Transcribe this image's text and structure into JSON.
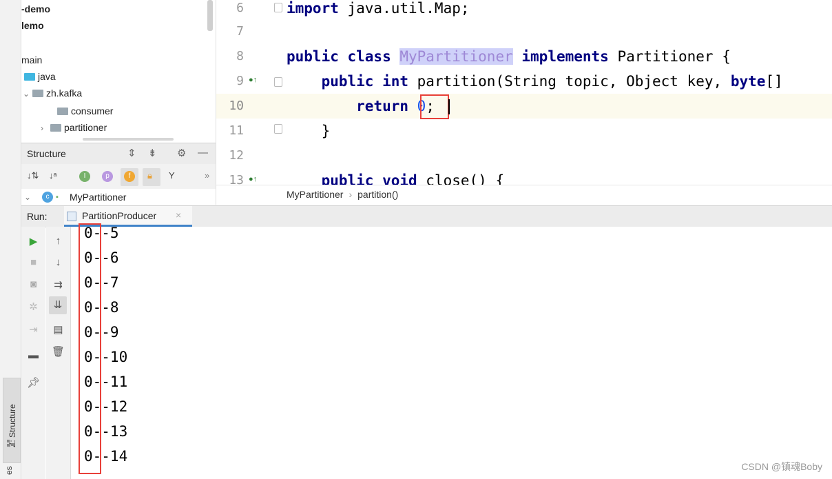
{
  "project_tree": {
    "items": [
      {
        "label": "-demo",
        "bold": true
      },
      {
        "label": "lemo",
        "bold": true
      },
      {
        "label": "main"
      },
      {
        "label": "java"
      },
      {
        "label": "zh.kafka"
      },
      {
        "label": "consumer"
      },
      {
        "label": "partitioner"
      }
    ]
  },
  "structure": {
    "title": "Structure",
    "class_name": "MyPartitioner",
    "icons": [
      "sort-by-visibility-icon",
      "sort-alphabetically-icon",
      "show-inherited-icon",
      "show-properties-icon",
      "show-fields-icon",
      "show-non-public-icon",
      "show-lambdas-icon",
      "more-icon"
    ]
  },
  "editor": {
    "line_numbers": [
      "6",
      "7",
      "8",
      "9",
      "10",
      "11",
      "12",
      "13"
    ],
    "lines": {
      "l6_kw": "import",
      "l6_rest": " java.util.Map;",
      "l8_kw1": "public class ",
      "l8_name": "MyPartitioner",
      "l8_kw2": " implements",
      "l8_rest": " Partitioner {",
      "l9_indent": "    ",
      "l9_kw": "public int",
      "l9_rest": " partition(String topic, Object key, ",
      "l9_kw2": "byte",
      "l9_tail": "[]",
      "l10_indent": "        ",
      "l10_kw": "return",
      "l10_space": " ",
      "l10_num": "0",
      "l10_tail": ";",
      "l11": "    }",
      "l13_indent": "    ",
      "l13_kw": "public void",
      "l13_rest": " close() {"
    }
  },
  "breadcrumb": {
    "class": "MyPartitioner",
    "separator": "›",
    "method": "partition()"
  },
  "run_panel": {
    "label": "Run:",
    "tab_label": "PartitionProducer",
    "close_glyph": "×",
    "output": [
      "0--5",
      "0--6",
      "0--7",
      "0--8",
      "0--9",
      "0--10",
      "0--11",
      "0--12",
      "0--13",
      "0--14"
    ]
  },
  "side_tabs": {
    "z_structure": "Z: Structure",
    "bottom_cut": "es"
  },
  "watermark": "CSDN @镇魂Boby",
  "colors": {
    "keyword": "#000080",
    "number": "#1750eb",
    "highlight_bg": "#cfd1f9",
    "annotation_red": "#e8403a",
    "tab_underline": "#4083c9"
  }
}
